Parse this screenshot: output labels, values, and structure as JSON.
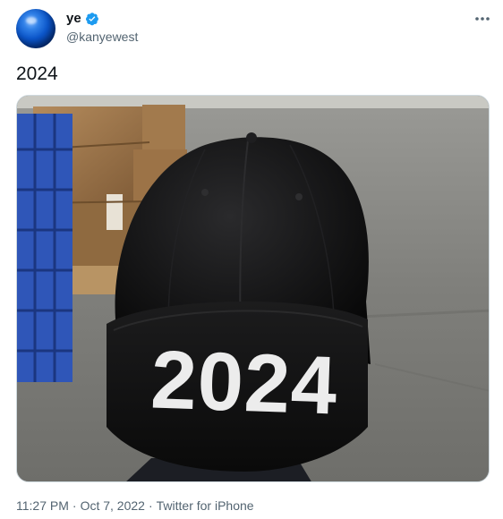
{
  "user": {
    "display_name": "ye",
    "handle": "@kanyewest",
    "verified": true
  },
  "tweet": {
    "text": "2024",
    "time": "11:27 PM",
    "date": "Oct 7, 2022",
    "source": "Twitter for iPhone",
    "separator": "·"
  },
  "media": {
    "cap_text": "2024"
  },
  "colors": {
    "verified_blue": "#1d9bf0",
    "meta_gray": "#536471",
    "text": "#0f1419"
  },
  "icons": [
    "verified-badge-icon",
    "more-options-icon"
  ]
}
